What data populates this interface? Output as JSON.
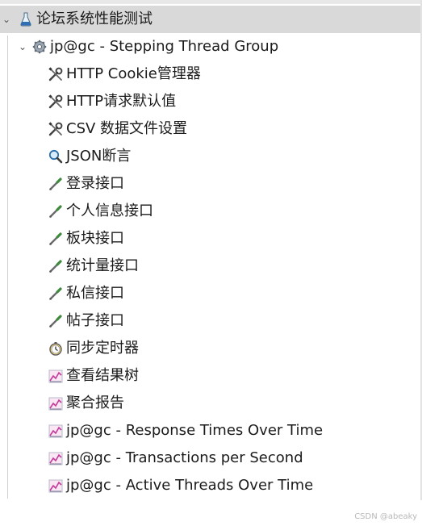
{
  "tree": {
    "root": {
      "label": "论坛系统性能测试",
      "icon": "test-plan-flask-icon"
    },
    "group": {
      "label": "jp@gc - Stepping Thread Group",
      "icon": "gear-icon"
    },
    "children": [
      {
        "label": "HTTP Cookie管理器",
        "icon": "wrench-config-icon"
      },
      {
        "label": "HTTP请求默认值",
        "icon": "wrench-config-icon"
      },
      {
        "label": "CSV 数据文件设置",
        "icon": "wrench-config-icon"
      },
      {
        "label": "JSON断言",
        "icon": "magnifier-assertion-icon"
      },
      {
        "label": "登录接口",
        "icon": "pipette-sampler-icon"
      },
      {
        "label": "个人信息接口",
        "icon": "pipette-sampler-icon"
      },
      {
        "label": "板块接口",
        "icon": "pipette-sampler-icon"
      },
      {
        "label": "统计量接口",
        "icon": "pipette-sampler-icon"
      },
      {
        "label": "私信接口",
        "icon": "pipette-sampler-icon"
      },
      {
        "label": "帖子接口",
        "icon": "pipette-sampler-icon"
      },
      {
        "label": "同步定时器",
        "icon": "timer-icon"
      },
      {
        "label": "查看结果树",
        "icon": "chart-listener-icon"
      },
      {
        "label": "聚合报告",
        "icon": "chart-listener-icon"
      },
      {
        "label": "jp@gc - Response Times Over Time",
        "icon": "chart-listener-icon"
      },
      {
        "label": "jp@gc - Transactions per Second",
        "icon": "chart-listener-icon"
      },
      {
        "label": "jp@gc - Active Threads Over Time",
        "icon": "chart-listener-icon"
      }
    ]
  },
  "watermark": "CSDN @abeaky"
}
